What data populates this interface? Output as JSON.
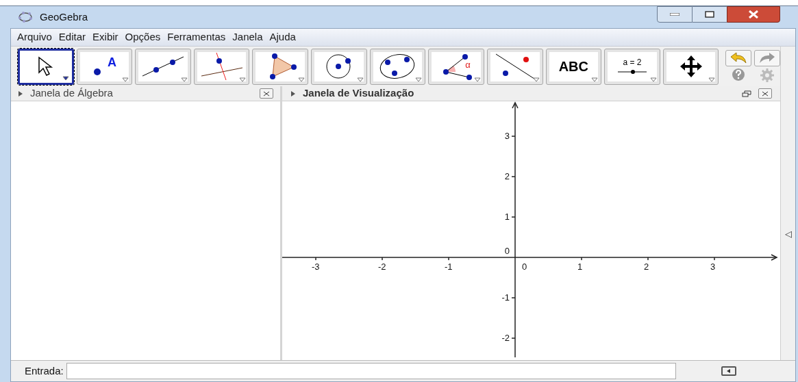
{
  "window": {
    "title": "GeoGebra"
  },
  "menu": [
    "Arquivo",
    "Editar",
    "Exibir",
    "Opções",
    "Ferramentas",
    "Janela",
    "Ajuda"
  ],
  "tools": [
    {
      "kind": "move",
      "selected": true
    },
    {
      "kind": "point",
      "label": "A",
      "selected": false
    },
    {
      "kind": "line",
      "selected": false
    },
    {
      "kind": "perpendicular",
      "selected": false
    },
    {
      "kind": "polygon",
      "selected": false
    },
    {
      "kind": "circle",
      "selected": false
    },
    {
      "kind": "conic",
      "selected": false
    },
    {
      "kind": "angle",
      "label": "α",
      "selected": false
    },
    {
      "kind": "reflect",
      "selected": false
    },
    {
      "kind": "text",
      "label": "ABC",
      "selected": false
    },
    {
      "kind": "slider",
      "label": "a = 2",
      "selected": false
    },
    {
      "kind": "move_view",
      "selected": false
    }
  ],
  "algebra_panel": {
    "title": "Janela de Álgebra"
  },
  "graphics_panel": {
    "title": "Janela de Visualização",
    "x_labels": [
      "-3",
      "-2",
      "-1",
      "0",
      "1",
      "2",
      "3"
    ],
    "y_labels": [
      "3",
      "2",
      "1",
      "0",
      "-1",
      "-2"
    ]
  },
  "side_toggle": "◁",
  "input_bar": {
    "label": "Entrada:"
  }
}
